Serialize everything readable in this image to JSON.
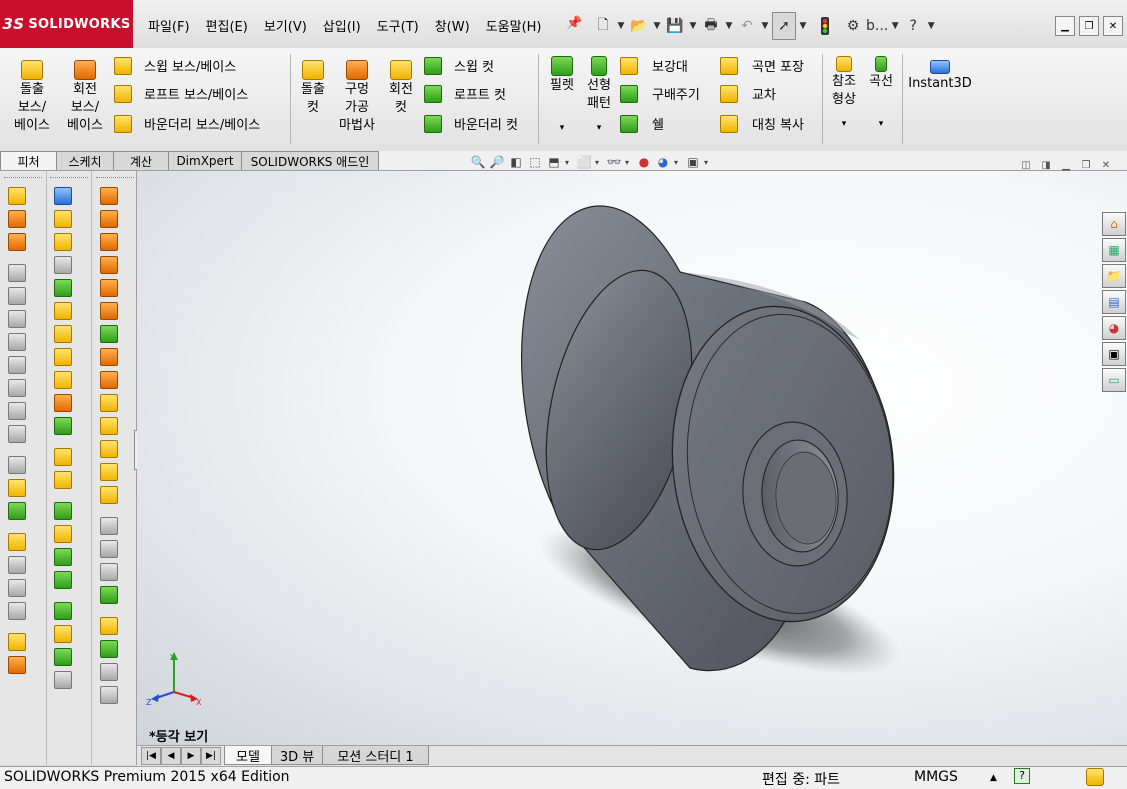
{
  "app": {
    "logo_text": "SOLIDWORKS",
    "logo_mark": "3S",
    "menus": [
      "파일(F)",
      "편집(E)",
      "보기(V)",
      "삽입(I)",
      "도구(T)",
      "창(W)",
      "도움말(H)"
    ],
    "quick_more_label": "b...",
    "help_label": "?"
  },
  "ribbon": {
    "extrude_boss": "돌출\n보스/\n베이스",
    "revolve_boss": "회전\n보스/\n베이스",
    "sweep_boss": "스윕 보스/베이스",
    "loft_boss": "로프트 보스/베이스",
    "boundary_boss": "바운더리 보스/베이스",
    "extrude_cut": "돌출\n컷",
    "hole_wizard": "구멍\n가공\n마법사",
    "revolve_cut": "회전\n컷",
    "sweep_cut": "스윕 컷",
    "loft_cut": "로프트 컷",
    "boundary_cut": "바운더리 컷",
    "fillet": "필렛",
    "linear_pattern": "선형\n패턴",
    "rib": "보강대",
    "wrap": "곡면 포장",
    "draft": "구배주기",
    "intersect": "교차",
    "shell": "쉘",
    "mirror": "대칭 복사",
    "ref_geometry": "참조\n형상",
    "curves": "곡선",
    "instant3d": "Instant3D"
  },
  "tabs": [
    "피처",
    "스케치",
    "계산",
    "DimXpert",
    "SOLIDWORKS 애드인"
  ],
  "viewport": {
    "view_name": "*등각 보기",
    "triad_labels": {
      "y": "Y",
      "x": "X",
      "z": "Z"
    }
  },
  "bottom_tabs": [
    "모델",
    "3D 뷰",
    "모션 스터디 1"
  ],
  "status": {
    "edition": "SOLIDWORKS Premium 2015 x64 Edition",
    "edit_state": "편집 중: 파트",
    "units": "MMGS",
    "units_arrow": "▲"
  },
  "colors": {
    "brand_red": "#c8102e",
    "part_gray": "#6d7079"
  },
  "icons": {
    "logo": "solidworks-logo-icon",
    "pin": "pin-icon",
    "new": "new-document-icon",
    "open": "open-folder-icon",
    "save": "save-icon",
    "print": "print-icon",
    "undo": "undo-icon",
    "select": "select-arrow-icon",
    "rebuild": "traffic-light-rebuild-icon",
    "options": "options-icon"
  }
}
